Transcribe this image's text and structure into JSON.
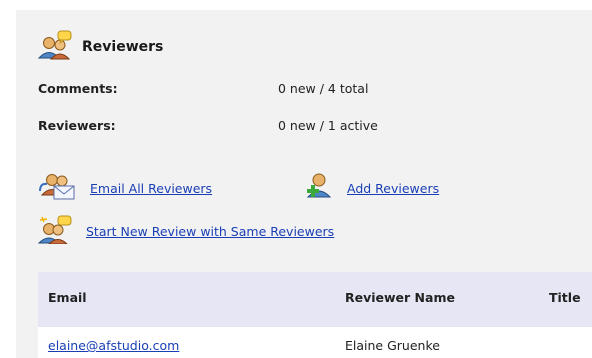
{
  "header": {
    "title": "Reviewers",
    "icon": "reviewers-group-icon"
  },
  "stats": [
    {
      "label": "Comments:",
      "value": "0 new / 4 total"
    },
    {
      "label": "Reviewers:",
      "value": "0 new / 1 active"
    }
  ],
  "actions": {
    "email_all": "Email All Reviewers",
    "add_reviewers": "Add Reviewers",
    "start_new_review": "Start New Review with Same Reviewers"
  },
  "table": {
    "columns": [
      "Email",
      "Reviewer Name",
      "Title"
    ],
    "rows": [
      {
        "email": "elaine@afstudio.com",
        "name": "Elaine Gruenke",
        "title": ""
      }
    ]
  }
}
